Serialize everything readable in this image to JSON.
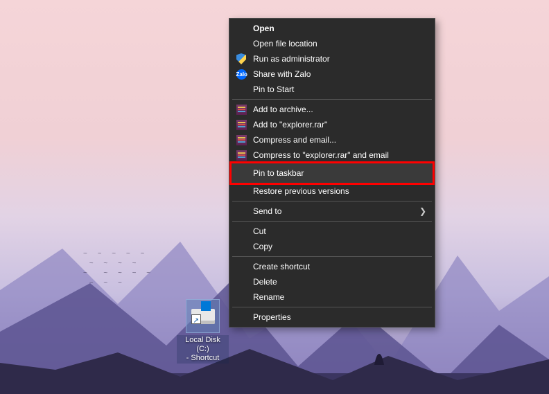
{
  "desktop_icon": {
    "label_line1": "Local Disk (C:)",
    "label_line2": "- Shortcut"
  },
  "context_menu": {
    "open": "Open",
    "open_file_location": "Open file location",
    "run_as_admin": "Run as administrator",
    "share_with_zalo": "Share with Zalo",
    "pin_to_start": "Pin to Start",
    "add_to_archive": "Add to archive...",
    "add_to_explorer_rar": "Add to \"explorer.rar\"",
    "compress_and_email": "Compress and email...",
    "compress_to_explorer_email": "Compress to \"explorer.rar\" and email",
    "pin_to_taskbar": "Pin to taskbar",
    "restore_previous": "Restore previous versions",
    "send_to": "Send to",
    "cut": "Cut",
    "copy": "Copy",
    "create_shortcut": "Create shortcut",
    "delete": "Delete",
    "rename": "Rename",
    "properties": "Properties",
    "zalo_badge": "Zalo"
  }
}
